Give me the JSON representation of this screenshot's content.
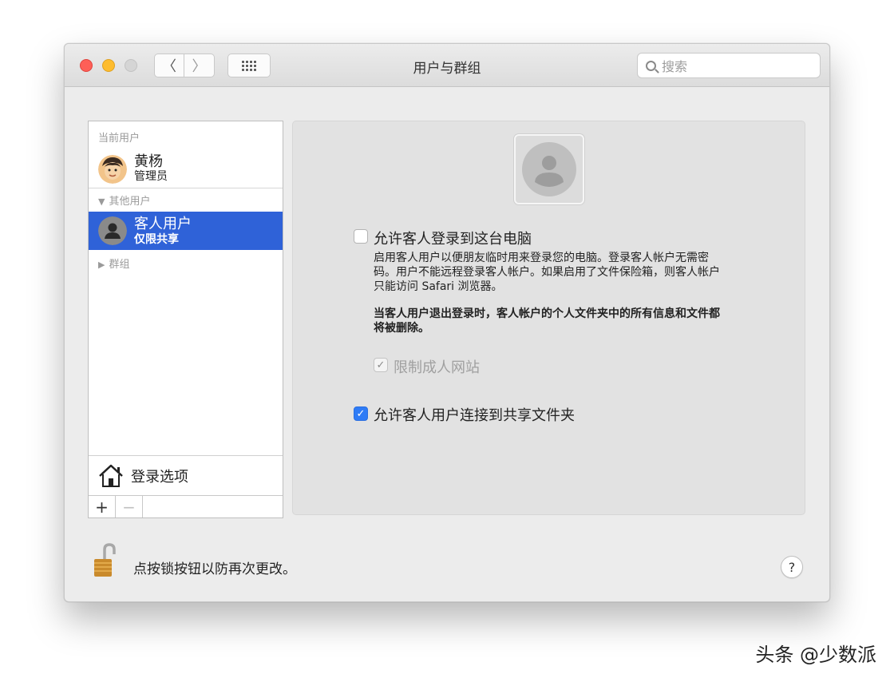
{
  "window": {
    "title": "用户与群组"
  },
  "toolbar": {
    "back_glyph": "〈",
    "forward_glyph": "〉",
    "search_placeholder": "搜索"
  },
  "sidebar": {
    "current_users_header": "当前用户",
    "current_user": {
      "name": "黄杨",
      "role": "管理员"
    },
    "other_users_header": "其他用户",
    "guest_user": {
      "name": "客人用户",
      "role": "仅限共享"
    },
    "groups_header": "群组",
    "login_options_label": "登录选项",
    "add_label": "+",
    "remove_label": "−"
  },
  "main": {
    "allow_login_label": "允许客人登录到这台电脑",
    "allow_login_checked": false,
    "description_lines": [
      "启用客人用户以便朋友临时用来登录您的电脑。登录客人帐户无需密",
      "码。用户不能远程登录客人帐户。如果启用了文件保险箱，则客人帐户",
      "只能访问 Safari 浏览器。"
    ],
    "warning_lines": [
      "当客人用户退出登录时，客人帐户的个人文件夹中的所有信息和文件都",
      "将被删除。"
    ],
    "limit_adult_label": "限制成人网站",
    "limit_adult_checked": true,
    "allow_shared_label": "允许客人用户连接到共享文件夹",
    "allow_shared_checked": true
  },
  "footer": {
    "lock_text": "点按锁按钮以防再次更改。",
    "help_label": "?"
  },
  "watermark": "头条 @少数派",
  "colors": {
    "selection": "#2f62d8",
    "checkbox_on": "#2f7cf6"
  }
}
